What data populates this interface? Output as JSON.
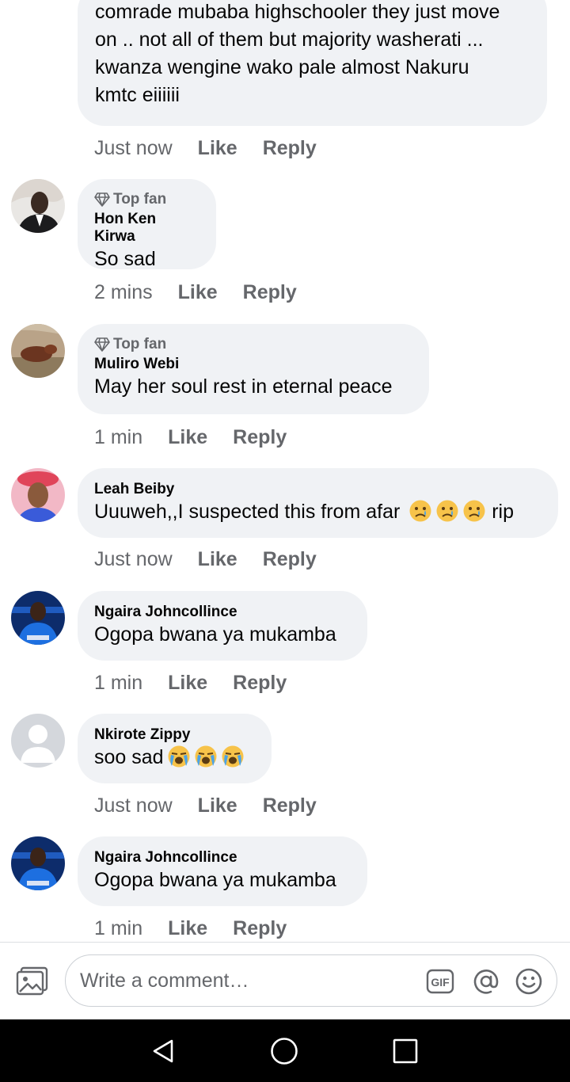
{
  "top_comment": {
    "lines": [
      "comrade mubaba highschooler they just move",
      "on .. not all of them but majority washerati ...",
      "kwanza wengine wako pale almost Nakuru",
      "kmtc eiiiiii"
    ],
    "time": "Just now",
    "like": "Like",
    "reply": "Reply"
  },
  "comments": [
    {
      "badge": "Top fan",
      "name": "Hon Ken Kirwa",
      "text": "So sad",
      "time": "2 mins",
      "like": "Like",
      "reply": "Reply"
    },
    {
      "badge": "Top fan",
      "name": "Muliro Webi",
      "text": "May her soul rest in eternal peace",
      "time": "1 min",
      "like": "Like",
      "reply": "Reply"
    },
    {
      "name": "Leah Beiby",
      "text": "Uuuweh,,I suspected this from afar",
      "text_after": "rip",
      "emojis": [
        "sad-tear",
        "sad-tear",
        "sad-tear"
      ],
      "time": "Just now",
      "like": "Like",
      "reply": "Reply"
    },
    {
      "name": "Ngaira Johncollince",
      "text": "Ogopa bwana ya mukamba",
      "time": "1 min",
      "like": "Like",
      "reply": "Reply"
    },
    {
      "name": "Nkirote Zippy",
      "text": "soo sad",
      "emojis": [
        "loudly-crying",
        "loudly-crying",
        "loudly-crying"
      ],
      "time": "Just now",
      "like": "Like",
      "reply": "Reply"
    },
    {
      "name": "Ngaira Johncollince",
      "text": "Ogopa bwana ya mukamba",
      "time": "1 min",
      "like": "Like",
      "reply": "Reply"
    }
  ],
  "composer": {
    "placeholder": "Write a comment…",
    "gif_label": "GIF",
    "icons": [
      "photo-icon",
      "gif-icon",
      "mention-icon",
      "emoji-icon"
    ]
  },
  "nav_icons": [
    "back-icon",
    "home-icon",
    "recents-icon"
  ],
  "colors": {
    "bubble": "#f0f2f5",
    "meta": "#65676b",
    "text": "#050505",
    "navbar": "#000000"
  }
}
